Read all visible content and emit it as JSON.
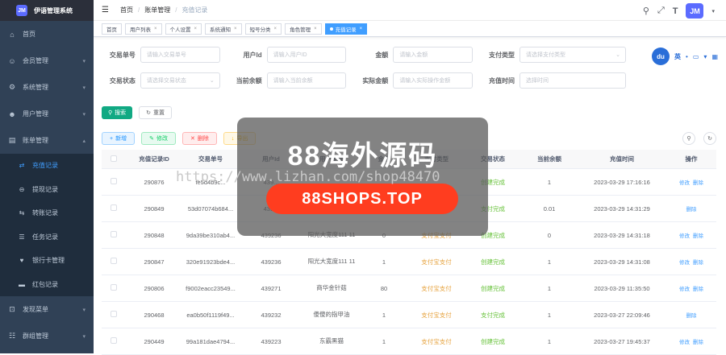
{
  "sidebar": {
    "logo_badge": "JM",
    "title": "伊语管理系统",
    "items": [
      {
        "label": "首页",
        "icon": "dashboard-icon"
      },
      {
        "label": "会员管理",
        "icon": "user-group-icon"
      },
      {
        "label": "系统管理",
        "icon": "gear-icon"
      },
      {
        "label": "用户管理",
        "icon": "user-icon"
      },
      {
        "label": "账单管理",
        "icon": "bill-icon"
      }
    ],
    "sub_items": [
      {
        "label": "充值记录",
        "icon": "recharge-icon",
        "active": true
      },
      {
        "label": "提现记录",
        "icon": "withdraw-icon"
      },
      {
        "label": "转账记录",
        "icon": "transfer-icon"
      },
      {
        "label": "任务记录",
        "icon": "task-icon"
      },
      {
        "label": "银行卡管理",
        "icon": "bank-card-icon"
      },
      {
        "label": "红包记录",
        "icon": "red-packet-icon"
      }
    ],
    "bottom_items": [
      {
        "label": "发现菜单",
        "icon": "discover-icon"
      },
      {
        "label": "群组管理",
        "icon": "group-icon"
      }
    ]
  },
  "navbar": {
    "breadcrumb": [
      "首页",
      "账单管理",
      "充值记录"
    ],
    "avatar_text": "JM"
  },
  "tags": [
    "首页",
    "用户列表",
    "个人设置",
    "系统通知",
    "短号分类",
    "角色管理",
    "充值记录"
  ],
  "filters": {
    "row1": [
      {
        "label": "交易单号",
        "placeholder": "请输入交易单号"
      },
      {
        "label": "用户Id",
        "placeholder": "请输入用户ID"
      },
      {
        "label": "金额",
        "placeholder": "请输入金额"
      },
      {
        "label": "支付类型",
        "placeholder": "请选择支付类型"
      }
    ],
    "row2": [
      {
        "label": "交易状态",
        "placeholder": "请选择交易状态"
      },
      {
        "label": "当前余额",
        "placeholder": "请输入当前余额"
      },
      {
        "label": "实际金额",
        "placeholder": "请输入实际操作金额"
      },
      {
        "label": "充值时间",
        "placeholder": "选择时间"
      }
    ]
  },
  "buttons": {
    "search": "搜索",
    "reset": "重置"
  },
  "actions": {
    "add": "新增",
    "edit": "修改",
    "delete": "删除",
    "export": "导出"
  },
  "ext": {
    "logo": "du",
    "lang": "英"
  },
  "table": {
    "headers": [
      "",
      "充值记录ID",
      "交易单号",
      "用户Id",
      "用户昵称",
      "金额",
      "支付类型",
      "交易状态",
      "当前余额",
      "充值时间",
      "操作"
    ],
    "rows": [
      {
        "id": "290876",
        "order": "fe5d4b9c...",
        "uid": "439...",
        "nick": "",
        "amount": "",
        "pay": "",
        "status": "创建完成",
        "balance": "1",
        "time": "2023-03-29 17:16:16",
        "ops": [
          "修改",
          "删除"
        ]
      },
      {
        "id": "290849",
        "order": "53d07074b684...",
        "uid": "439...",
        "nick": "",
        "amount": "",
        "pay": "",
        "status": "支付完成",
        "balance": "0.01",
        "time": "2023-03-29 14:31:29",
        "ops": [
          "删除"
        ]
      },
      {
        "id": "290848",
        "order": "9da39be310ab4...",
        "uid": "439236",
        "nick": "阳光大宽度111 11",
        "amount": "0",
        "pay": "支付宝支付",
        "status": "创建完成",
        "balance": "0",
        "time": "2023-03-29 14:31:18",
        "ops": [
          "修改",
          "删除"
        ]
      },
      {
        "id": "290847",
        "order": "320e91923bde4...",
        "uid": "439236",
        "nick": "阳光大宽度111 11",
        "amount": "1",
        "pay": "支付宝支付",
        "status": "创建完成",
        "balance": "1",
        "time": "2023-03-29 14:31:08",
        "ops": [
          "修改",
          "删除"
        ]
      },
      {
        "id": "290806",
        "order": "f9002eacc23549...",
        "uid": "439271",
        "nick": "商华金针菇",
        "amount": "80",
        "pay": "支付宝支付",
        "status": "创建完成",
        "balance": "1",
        "time": "2023-03-29 11:35:50",
        "ops": [
          "修改",
          "删除"
        ]
      },
      {
        "id": "290468",
        "order": "ea0b50f1119f49...",
        "uid": "439232",
        "nick": "傻傻的指甲油",
        "amount": "1",
        "pay": "支付宝支付",
        "status": "支付完成",
        "balance": "1",
        "time": "2023-03-27 22:09:46",
        "ops": [
          "删除"
        ]
      },
      {
        "id": "290449",
        "order": "99a181dae4794...",
        "uid": "439223",
        "nick": "东霸黑猫",
        "amount": "1",
        "pay": "支付宝支付",
        "status": "创建完成",
        "balance": "1",
        "time": "2023-03-27 19:45:37",
        "ops": [
          "修改",
          "删除"
        ]
      }
    ]
  },
  "watermark": {
    "title": "88海外源码",
    "pill": "88SHOPS.TOP",
    "url": "https://www.lizhan.com/shop48470"
  }
}
